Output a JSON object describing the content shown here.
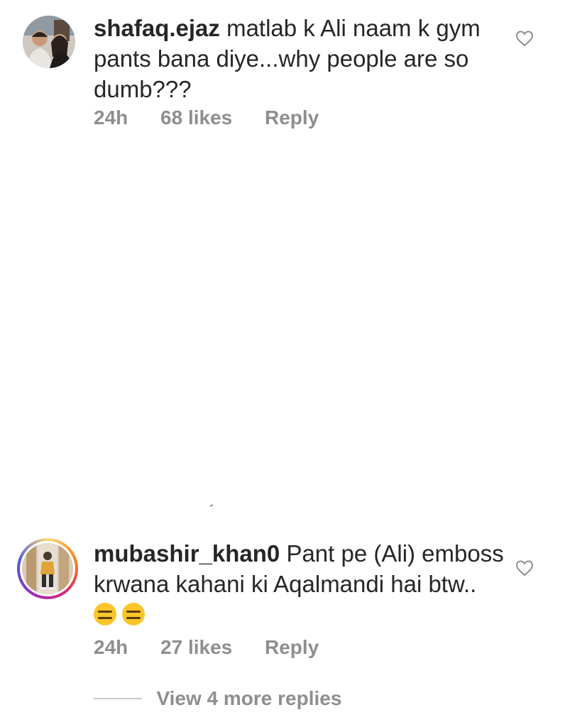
{
  "comments": [
    {
      "username": "shafaq.ejaz",
      "text": "matlab k Ali naam k gym pants bana diye...why people are so dumb???",
      "time": "24h",
      "likes": "68 likes",
      "reply_label": "Reply",
      "avatar_icon": "user-avatar-photo",
      "has_story_ring": false
    },
    {
      "username": "mubashir_khan0",
      "text": "Pant pe (Ali) emboss krwana kahani ki Aqalmandi hai btw..",
      "emojis": [
        "expressionless-face-emoji",
        "expressionless-face-emoji"
      ],
      "time": "24h",
      "likes": "27 likes",
      "reply_label": "Reply",
      "avatar_icon": "user-avatar-photo",
      "has_story_ring": true
    }
  ],
  "view_replies": {
    "label": "View 4 more replies"
  },
  "icons": {
    "like": "heart-outline-icon"
  },
  "colors": {
    "text": "#262626",
    "meta": "#8e8e8e",
    "heart": "#8e8e8e",
    "emoji": "#f9c52a"
  }
}
